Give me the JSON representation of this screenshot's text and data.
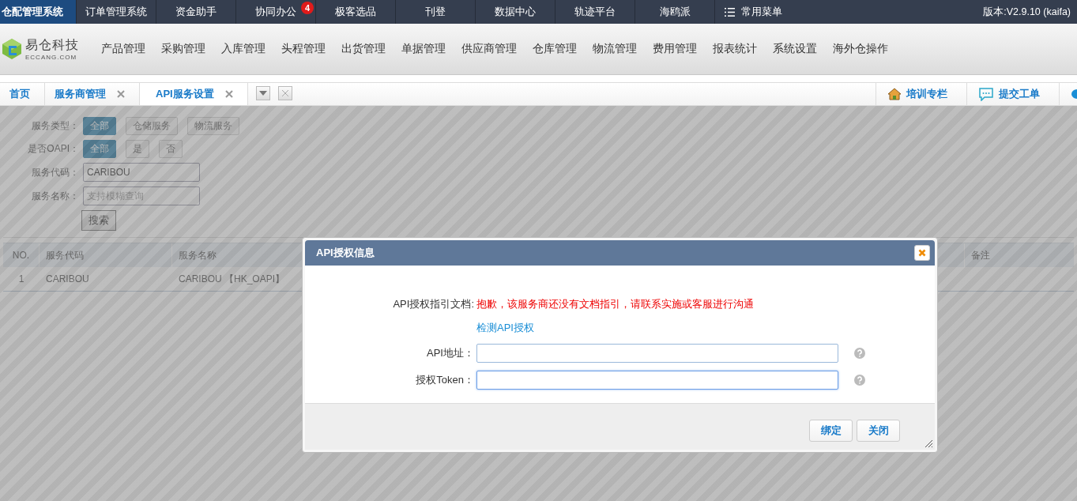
{
  "top_bar": {
    "items": [
      {
        "label": "仓配管理系统",
        "selected": true
      },
      {
        "label": "订单管理系统",
        "selected": false
      },
      {
        "label": "资金助手",
        "selected": false
      },
      {
        "label": "协同办公",
        "selected": false,
        "badge": "4"
      },
      {
        "label": "极客选品",
        "selected": false
      },
      {
        "label": "刊登",
        "selected": false
      },
      {
        "label": "数据中心",
        "selected": false
      },
      {
        "label": "轨迹平台",
        "selected": false
      },
      {
        "label": "海鸥派",
        "selected": false
      }
    ],
    "menu": "常用菜单",
    "version": "版本:V2.9.10 (kaifa)"
  },
  "logo": {
    "name": "易仓科技",
    "sub": "ECCANG.COM"
  },
  "nav": [
    "产品管理",
    "采购管理",
    "入库管理",
    "头程管理",
    "出货管理",
    "单据管理",
    "供应商管理",
    "仓库管理",
    "物流管理",
    "费用管理",
    "报表统计",
    "系统设置",
    "海外仓操作"
  ],
  "tabs": [
    {
      "label": "首页",
      "selected": false,
      "closable": false
    },
    {
      "label": "服务商管理",
      "selected": false,
      "closable": true
    },
    {
      "label": "API服务设置",
      "selected": true,
      "closable": true
    }
  ],
  "quick_links": [
    {
      "kind": "home",
      "label": "培训专栏"
    },
    {
      "kind": "chat",
      "label": "提交工单"
    }
  ],
  "filters": {
    "groups": [
      {
        "label": "服务类型：",
        "options": [
          {
            "label": "全部",
            "selected": true
          },
          {
            "label": "仓储服务",
            "selected": false
          },
          {
            "label": "物流服务",
            "selected": false
          }
        ]
      },
      {
        "label": "是否OAPI：",
        "options": [
          {
            "label": "全部",
            "selected": true
          },
          {
            "label": "是",
            "selected": false
          },
          {
            "label": "否",
            "selected": false
          }
        ]
      }
    ],
    "fields": [
      {
        "label": "服务代码：",
        "value": "CARIBOU"
      },
      {
        "label": "服务名称：",
        "placeholder": "支持模糊查询"
      }
    ],
    "search_button": "搜索"
  },
  "table": {
    "columns": [
      "NO.",
      "服务代码",
      "服务名称",
      "备注"
    ],
    "rows": [
      [
        "1",
        "CARIBOU",
        "CARIBOU 【HK_OAPI】"
      ]
    ]
  },
  "dialog": {
    "title": "API授权信息",
    "doc_label": "API授权指引文档:",
    "doc_message": "抱歉，该服务商还没有文档指引，请联系实施或客服进行沟通",
    "check_link": "检测API授权",
    "fields": [
      {
        "label": "API地址：",
        "focused": false
      },
      {
        "label": "授权Token：",
        "focused": true
      }
    ],
    "buttons": [
      "绑定",
      "关闭"
    ]
  }
}
